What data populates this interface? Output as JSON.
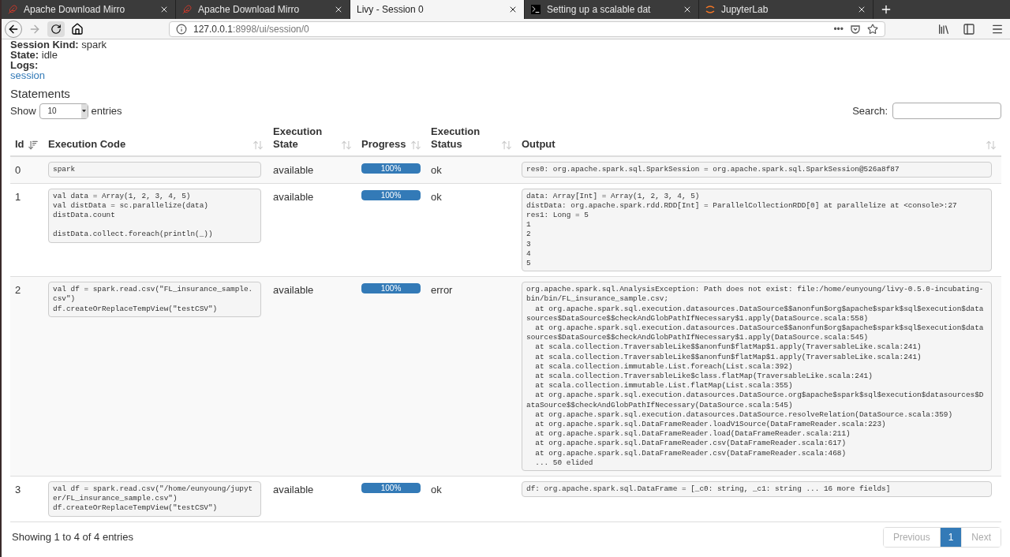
{
  "browser": {
    "tabs": [
      {
        "title": "Apache Download Mirro",
        "kind": "feather",
        "selected": false
      },
      {
        "title": "Apache Download Mirro",
        "kind": "feather",
        "selected": false
      },
      {
        "title": "Livy - Session 0",
        "kind": "plain",
        "selected": true
      },
      {
        "title": "Setting up a scalable dat",
        "kind": "terminal",
        "selected": false
      },
      {
        "title": "JupyterLab",
        "kind": "jupyter",
        "selected": false
      }
    ],
    "url_host": "127.0.0.1",
    "url_path": ":8998/ui/session/0",
    "page_actions": "•••"
  },
  "session_info": [
    {
      "label": "Session Kind:",
      "value": "spark"
    },
    {
      "label": "State:",
      "value": "idle"
    },
    {
      "label": "Logs:"
    }
  ],
  "logs_link": "session",
  "statements": {
    "title": "Statements",
    "show_label": "Show",
    "page_size": "10",
    "entries_label": "entries",
    "search_label": "Search:",
    "columns": [
      {
        "label": "Id",
        "sorted": true
      },
      {
        "label": "Execution Code",
        "sorted": false
      },
      {
        "label": "Execution State",
        "sorted": false
      },
      {
        "label": "Progress",
        "sorted": false
      },
      {
        "label": "Execution Status",
        "sorted": false
      },
      {
        "label": "Output",
        "sorted": false
      }
    ],
    "rows": [
      {
        "id": "0",
        "code": "spark",
        "state": "available",
        "level": 1,
        "progress": "100%",
        "status": "ok",
        "output": "res0: org.apache.spark.sql.SparkSession = org.apache.spark.sql.SparkSession@526a8f87"
      },
      {
        "id": "1",
        "code": "val data = Array(1, 2, 3, 4, 5)\nval distData = sc.parallelize(data)\ndistData.count\n\ndistData.collect.foreach(println(_))",
        "state": "available",
        "level": 1,
        "progress": "100%",
        "status": "ok",
        "output": "data: Array[Int] = Array(1, 2, 3, 4, 5)\ndistData: org.apache.spark.rdd.RDD[Int] = ParallelCollectionRDD[0] at parallelize at <console>:27\nres1: Long = 5\n1\n2\n3\n4\n5"
      },
      {
        "id": "2",
        "code": "val df = spark.read.csv(\"FL_insurance_sample.csv\")\ndf.createOrReplaceTempView(\"testCSV\")",
        "state": "available",
        "level": 1,
        "progress": "100%",
        "status": "error",
        "output": "org.apache.spark.sql.AnalysisException: Path does not exist: file:/home/eunyoung/livy-0.5.0-incubating-bin/bin/FL_insurance_sample.csv;\n  at org.apache.spark.sql.execution.datasources.DataSource$$anonfun$org$apache$spark$sql$execution$datasources$DataSource$$checkAndGlobPathIfNecessary$1.apply(DataSource.scala:558)\n  at org.apache.spark.sql.execution.datasources.DataSource$$anonfun$org$apache$spark$sql$execution$datasources$DataSource$$checkAndGlobPathIfNecessary$1.apply(DataSource.scala:545)\n  at scala.collection.TraversableLike$$anonfun$flatMap$1.apply(TraversableLike.scala:241)\n  at scala.collection.TraversableLike$$anonfun$flatMap$1.apply(TraversableLike.scala:241)\n  at scala.collection.immutable.List.foreach(List.scala:392)\n  at scala.collection.TraversableLike$class.flatMap(TraversableLike.scala:241)\n  at scala.collection.immutable.List.flatMap(List.scala:355)\n  at org.apache.spark.sql.execution.datasources.DataSource.org$apache$spark$sql$execution$datasources$DataSource$$checkAndGlobPathIfNecessary(DataSource.scala:545)\n  at org.apache.spark.sql.execution.datasources.DataSource.resolveRelation(DataSource.scala:359)\n  at org.apache.spark.sql.DataFrameReader.loadV1Source(DataFrameReader.scala:223)\n  at org.apache.spark.sql.DataFrameReader.load(DataFrameReader.scala:211)\n  at org.apache.spark.sql.DataFrameReader.csv(DataFrameReader.scala:617)\n  at org.apache.spark.sql.DataFrameReader.csv(DataFrameReader.scala:468)\n  ... 50 elided"
      },
      {
        "id": "3",
        "code": "val df = spark.read.csv(\"/home/eunyoung/jupyter/FL_insurance_sample.csv\")\ndf.createOrReplaceTempView(\"testCSV\")",
        "state": "available",
        "level": 1,
        "progress": "100%",
        "status": "ok",
        "output": "df: org.apache.spark.sql.DataFrame = [_c0: string, _c1: string ... 16 more fields]"
      }
    ],
    "info": "Showing 1 to 4 of 4 entries",
    "pagination": [
      {
        "label": "Previous",
        "kind": "nav",
        "selected": false,
        "disabled": true
      },
      {
        "label": "1",
        "kind": "page",
        "selected": true,
        "disabled": false
      },
      {
        "label": "Next",
        "kind": "nav",
        "selected": false,
        "disabled": true
      }
    ]
  }
}
